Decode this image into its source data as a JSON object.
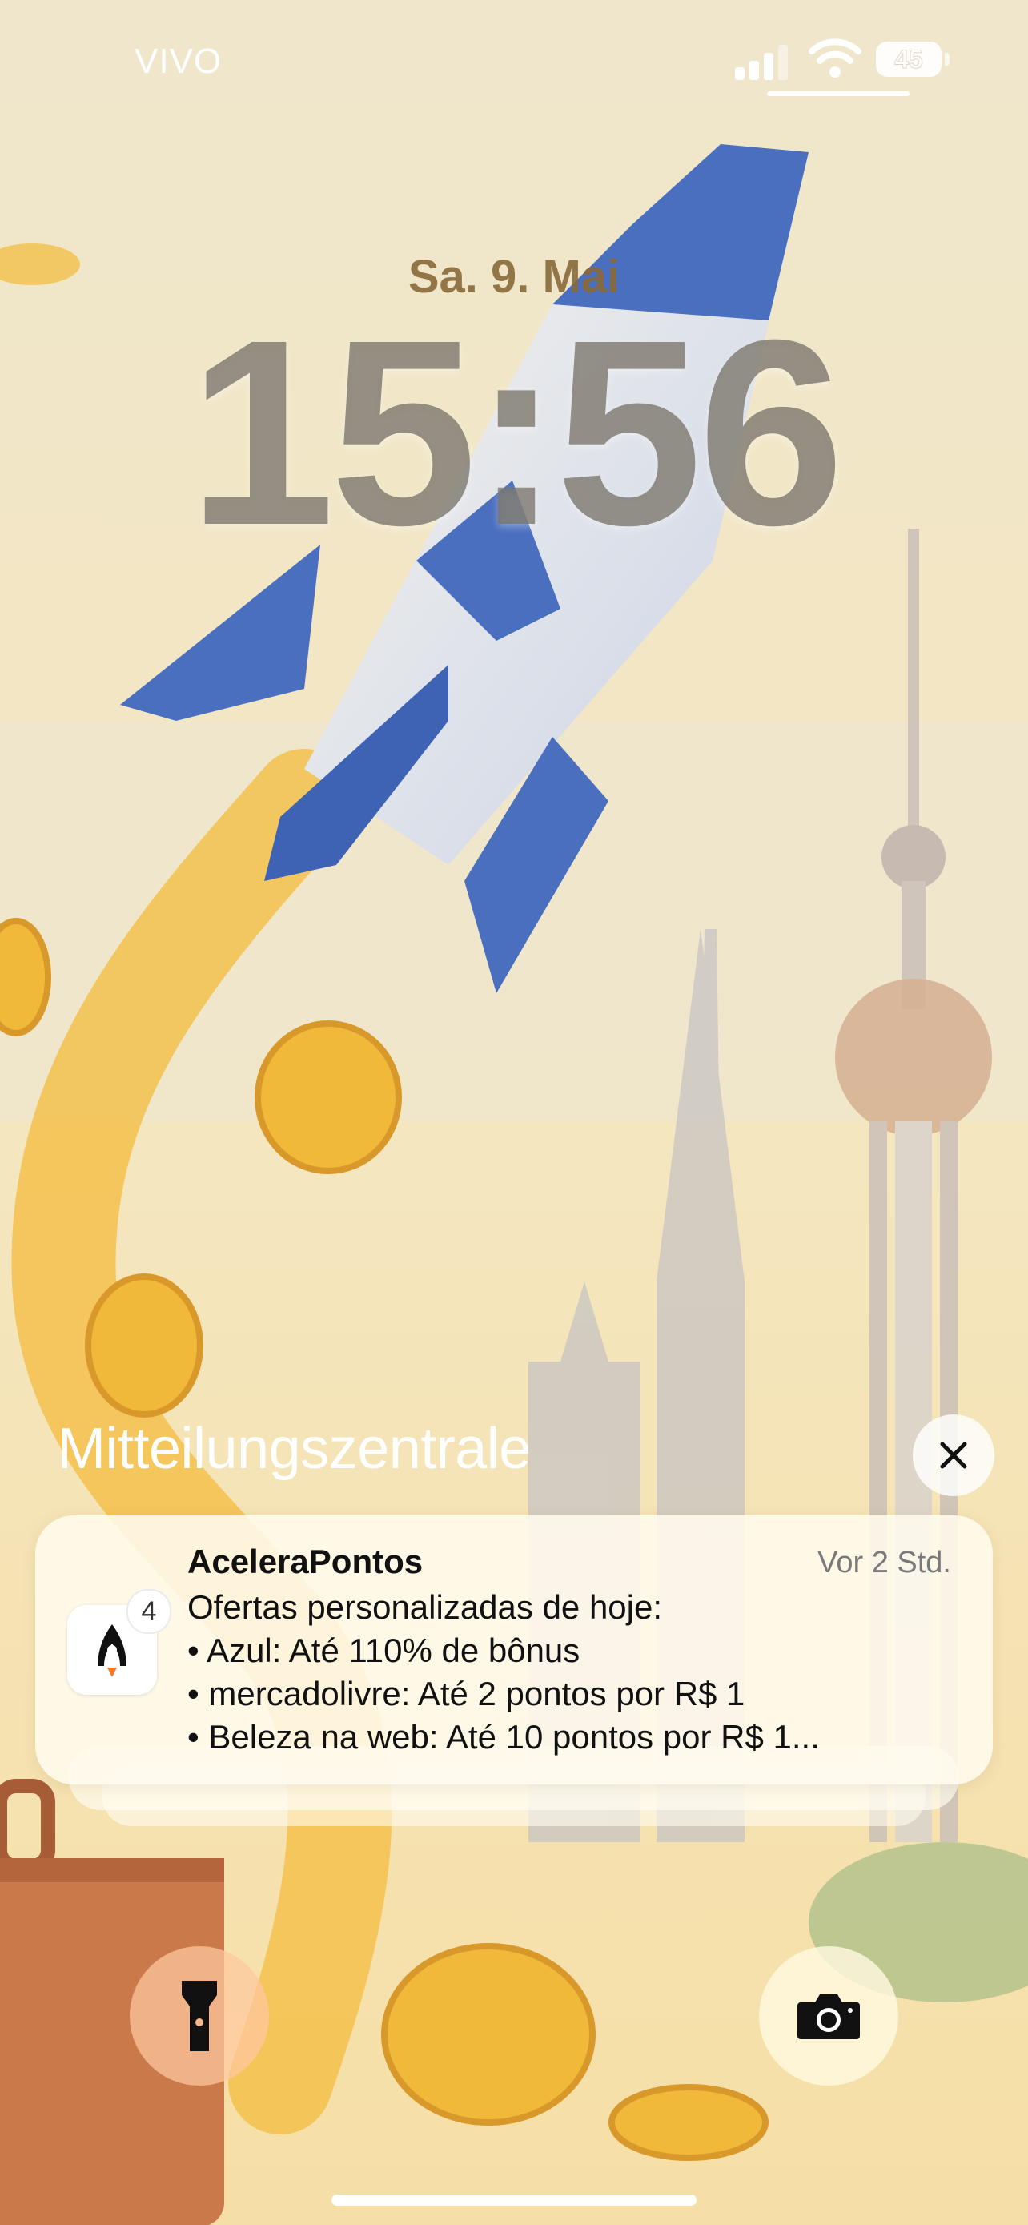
{
  "status_bar": {
    "carrier": "VIVO",
    "signal_icon": "cellular-signal-icon",
    "wifi_icon": "wifi-icon",
    "battery_level": "45"
  },
  "lock_screen": {
    "date": "Sa. 9. Mai",
    "time": "15:56"
  },
  "notification_center": {
    "title": "Mitteilungszentrale",
    "close_icon": "close-icon"
  },
  "notification": {
    "app_name": "AceleraPontos",
    "timestamp": "Vor 2 Std.",
    "badge_count": "4",
    "lines": [
      "Ofertas personalizadas de hoje:",
      "• Azul: Até 110% de bônus",
      "• mercadolivre: Até 2 pontos por R$ 1",
      "• Beleza na web: Até 10 pontos por R$ 1..."
    ]
  },
  "quick_actions": {
    "flashlight_icon": "flashlight-icon",
    "camera_icon": "camera-icon"
  },
  "colors": {
    "wallpaper_base": "#f3e6c2",
    "rocket_blue": "#4a6fbf",
    "coin_gold": "#f0b93a"
  }
}
